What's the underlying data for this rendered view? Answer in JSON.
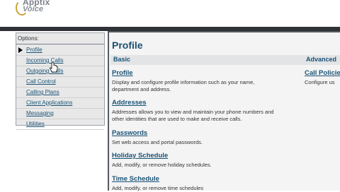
{
  "logo": {
    "line1": "Apptix",
    "line2": "Voice"
  },
  "sidebar": {
    "title": "Options:",
    "items": [
      {
        "label": "Profile"
      },
      {
        "label": "Incoming Calls"
      },
      {
        "label": "Outgoing Calls"
      },
      {
        "label": "Call Control"
      },
      {
        "label": "Calling Plans"
      },
      {
        "label": "Client Applications"
      },
      {
        "label": "Messaging"
      },
      {
        "label": "Utilities"
      }
    ]
  },
  "main": {
    "title": "Profile",
    "sections": {
      "basic": "Basic",
      "advanced": "Advanced"
    },
    "basic_items": [
      {
        "label": "Profile",
        "desc1": "Display and configure profile information such as your name,",
        "desc2": "department and address."
      },
      {
        "label": "Addresses",
        "desc1": "Addresses allows you to view and maintain your phone numbers and",
        "desc2": "other identities that are used to make and receive calls."
      },
      {
        "label": "Passwords",
        "desc1": "Set web access and portal passwords.",
        "desc2": ""
      },
      {
        "label": "Holiday Schedule",
        "desc1": "Add, modify, or remove holiday schedules.",
        "desc2": ""
      },
      {
        "label": "Time Schedule",
        "desc1": "Add, modify, or remove time schedules",
        "desc2": ""
      }
    ],
    "advanced_items": [
      {
        "label": "Call Policies",
        "desc1": "Configure us"
      }
    ]
  }
}
